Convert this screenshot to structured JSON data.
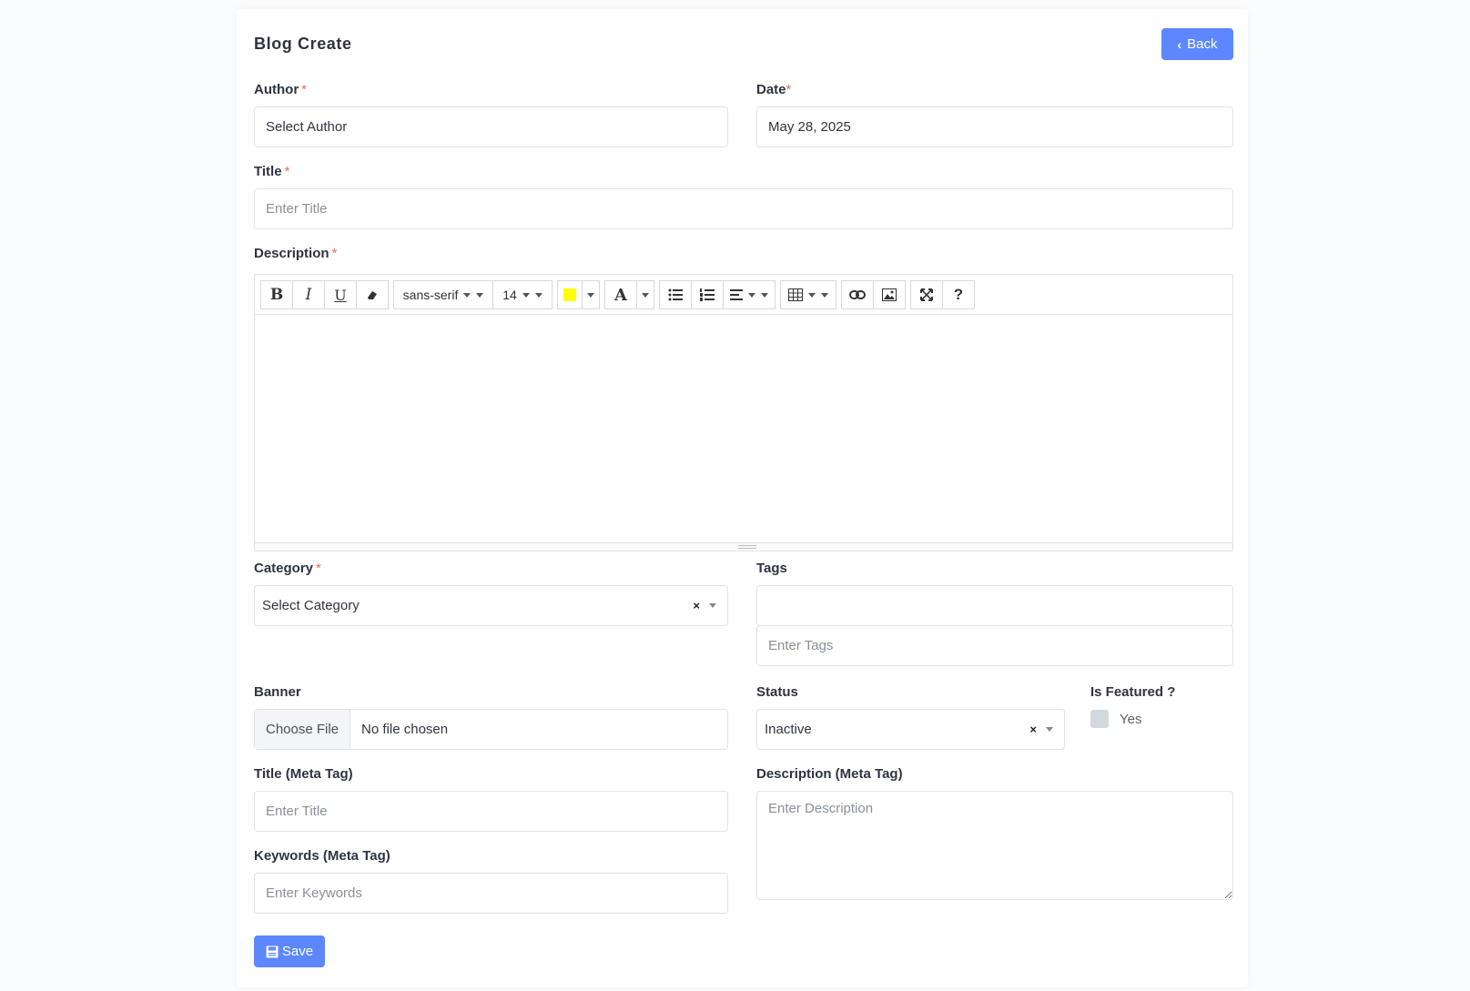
{
  "header": {
    "title": "Blog Create",
    "back_label": "Back"
  },
  "author": {
    "label": "Author",
    "required": "*",
    "value": "Select Author"
  },
  "date": {
    "label": "Date",
    "required": "*",
    "value": "May 28, 2025"
  },
  "title_field": {
    "label": "Title",
    "required": "*",
    "placeholder": "Enter Title"
  },
  "description": {
    "label": "Description",
    "required": "*",
    "toolbar": {
      "bold": "B",
      "italic": "I",
      "underline": "U",
      "font_family": "sans-serif",
      "font_size": "14",
      "text_color": "A",
      "help": "?",
      "highlight_color": "#ffff00"
    }
  },
  "category": {
    "label": "Category",
    "required": "*",
    "value": "Select Category",
    "clear": "×"
  },
  "tags": {
    "label": "Tags",
    "placeholder": "Enter Tags"
  },
  "banner": {
    "label": "Banner",
    "button": "Choose File",
    "status": "No file chosen"
  },
  "status": {
    "label": "Status",
    "value": "Inactive",
    "clear": "×"
  },
  "featured": {
    "label": "Is Featured ?",
    "option": "Yes"
  },
  "meta_title": {
    "label": "Title (Meta Tag)",
    "placeholder": "Enter Title"
  },
  "meta_description": {
    "label": "Description (Meta Tag)",
    "placeholder": "Enter Description"
  },
  "meta_keywords": {
    "label": "Keywords (Meta Tag)",
    "placeholder": "Enter Keywords"
  },
  "save_label": "Save",
  "colors": {
    "primary": "#5d87ff",
    "required": "#e2725b",
    "border": "#dfe3e8"
  }
}
